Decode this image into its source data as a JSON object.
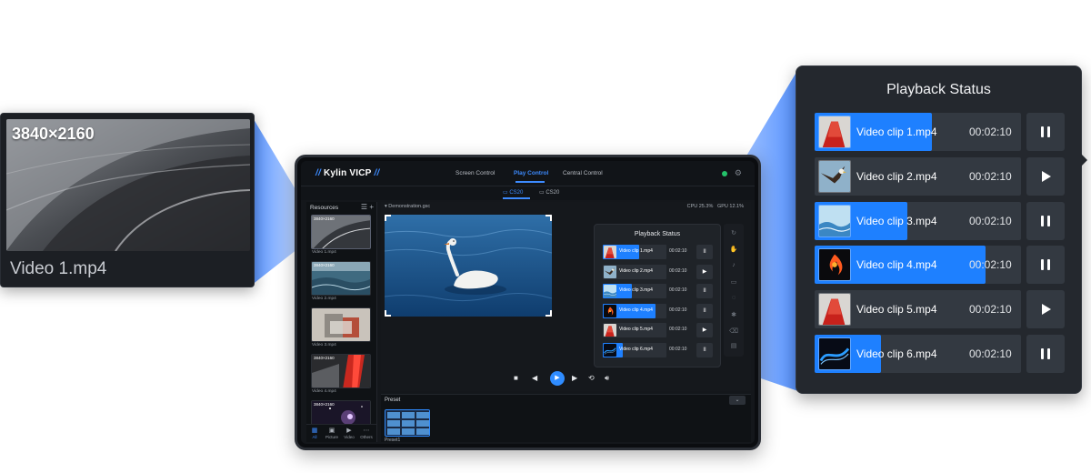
{
  "left_preview": {
    "resolution": "3840×2160",
    "file_name": "Video 1.mp4"
  },
  "app": {
    "logo": "Kylin VICP",
    "nav": [
      "Screen Control",
      "Play Control",
      "Central Control"
    ],
    "nav_active": "Play Control",
    "screens": [
      "CS20",
      "CS20"
    ],
    "cpu": "CPU 25.3%",
    "gpu": "GPU 12.1%",
    "file": "Demonstration.gsc",
    "sidebar_title": "Resources",
    "resources": [
      {
        "res": "3840×2160",
        "name": "Video 1.mp4"
      },
      {
        "res": "3840×2160",
        "name": "Video 2.mp4"
      },
      {
        "res": "",
        "name": "Video 3.mp4"
      },
      {
        "res": "3840×2160",
        "name": "Video 4.mp4"
      },
      {
        "res": "3840×2160",
        "name": ""
      }
    ],
    "filters": [
      "All",
      "Picture",
      "Video",
      "Others"
    ],
    "preset_title": "Preset",
    "preset_item": "Preset1",
    "mini_title": "Playback Status"
  },
  "playback": {
    "title": "Playback Status",
    "clips": [
      {
        "name": "Video clip 1.mp4",
        "duration": "00:02:10",
        "progress": 0.57,
        "state": "pause",
        "icon": "red-slide-icon"
      },
      {
        "name": "Video clip 2.mp4",
        "duration": "00:02:10",
        "progress": 0.0,
        "state": "play",
        "icon": "eagle-icon"
      },
      {
        "name": "Video clip 3.mp4",
        "duration": "00:02:10",
        "progress": 0.45,
        "state": "pause",
        "icon": "sea-icon"
      },
      {
        "name": "Video clip 4.mp4",
        "duration": "00:02:10",
        "progress": 0.83,
        "state": "pause",
        "icon": "fire-bird-icon"
      },
      {
        "name": "Video clip 5.mp4",
        "duration": "00:02:10",
        "progress": 0.0,
        "state": "play",
        "icon": "red-slide-icon"
      },
      {
        "name": "Video clip 6.mp4",
        "duration": "00:02:10",
        "progress": 0.32,
        "state": "pause",
        "icon": "blue-wave-icon"
      }
    ]
  },
  "colors": {
    "accent": "#1e80ff",
    "panel": "#24282e",
    "bar_track": "#333941"
  }
}
